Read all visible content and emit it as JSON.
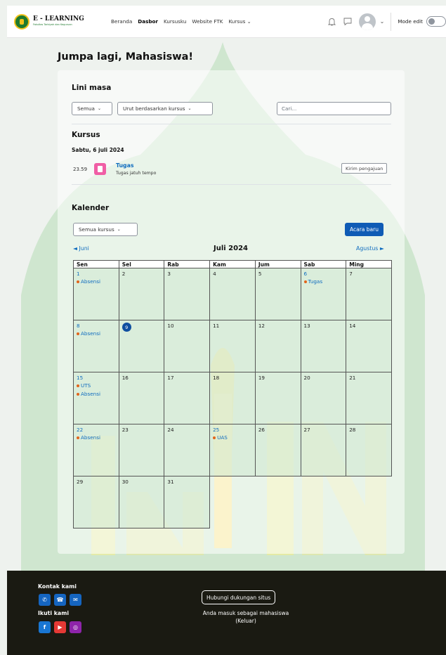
{
  "brand": {
    "title": "E - LEARNING",
    "subtitle": "Fakultas Tarbiyah dan Keguruan"
  },
  "nav": {
    "items": [
      {
        "label": "Beranda"
      },
      {
        "label": "Dasbor"
      },
      {
        "label": "Kursusku"
      },
      {
        "label": "Website FTK"
      },
      {
        "label": "Kursus"
      }
    ],
    "mode_edit_label": "Mode edit"
  },
  "page_title": "Jumpa lagi, Mahasiswa!",
  "timeline": {
    "title": "Lini masa",
    "filter_label": "Semua",
    "sort_label": "Urut berdasarkan kursus",
    "search_placeholder": "Cari..."
  },
  "courses": {
    "title": "Kursus",
    "date": "Sabtu, 6 juli 2024",
    "event": {
      "time": "23.59",
      "name": "Tugas",
      "subtitle": "Tugas jatuh tempo",
      "action": "Kirim pengajuan"
    }
  },
  "calendar": {
    "title": "Kalender",
    "course_filter": "Semua kursus",
    "new_event": "Acara baru",
    "prev_month": "Juni",
    "current_month": "Juli 2024",
    "next_month": "Agustus",
    "weekdays": [
      "Sen",
      "Sel",
      "Rab",
      "Kam",
      "Jum",
      "Sab",
      "Ming"
    ],
    "weeks": [
      [
        {
          "day": "1",
          "link": true,
          "events": [
            "Absensi"
          ]
        },
        {
          "day": "2"
        },
        {
          "day": "3"
        },
        {
          "day": "4"
        },
        {
          "day": "5"
        },
        {
          "day": "6",
          "link": true,
          "events": [
            "Tugas"
          ]
        },
        {
          "day": "7"
        }
      ],
      [
        {
          "day": "8",
          "link": true,
          "events": [
            "Absensi"
          ]
        },
        {
          "day": "9",
          "today": true
        },
        {
          "day": "10"
        },
        {
          "day": "11"
        },
        {
          "day": "12"
        },
        {
          "day": "13"
        },
        {
          "day": "14"
        }
      ],
      [
        {
          "day": "15",
          "link": true,
          "events": [
            "UTS",
            "Absensi"
          ]
        },
        {
          "day": "16"
        },
        {
          "day": "17"
        },
        {
          "day": "18"
        },
        {
          "day": "19"
        },
        {
          "day": "20"
        },
        {
          "day": "21"
        }
      ],
      [
        {
          "day": "22",
          "link": true,
          "events": [
            "Absensi"
          ]
        },
        {
          "day": "23"
        },
        {
          "day": "24"
        },
        {
          "day": "25",
          "link": true,
          "events": [
            "UAS"
          ]
        },
        {
          "day": "26"
        },
        {
          "day": "27"
        },
        {
          "day": "28"
        }
      ],
      [
        {
          "day": "29"
        },
        {
          "day": "30"
        },
        {
          "day": "31"
        },
        null,
        null,
        null,
        null
      ]
    ]
  },
  "footer": {
    "contact_title": "Kontak kami",
    "follow_title": "Ikuti kami",
    "support_button": "Hubungi dukungan situs",
    "login_info": "Anda masuk sebagai mahasiswa",
    "logout": "(Keluar)",
    "colors": {
      "social_blue": "#1565c0",
      "youtube": "#e53935",
      "instagram": "#8e24aa",
      "facebook": "#1976d2"
    }
  }
}
